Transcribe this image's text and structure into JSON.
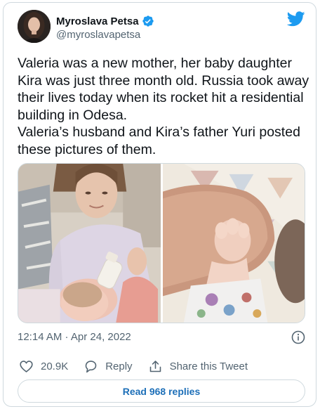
{
  "tweet": {
    "author": {
      "display_name": "Myroslava Petsa",
      "handle": "@myroslavapetsa",
      "verified": true
    },
    "text": "Valeria was a new mother, her baby daughter Kira was just three month old. Russia took away their lives today when its rocket hit a residential building in Odesa.\nValeria’s husband and Kira’s father Yuri posted these pictures of them.",
    "timestamp": "12:14 AM · Apr 24, 2022",
    "actions": {
      "likes": "20.9K",
      "reply_label": "Reply",
      "share_label": "Share this Tweet"
    },
    "read_replies_label": "Read 968 replies",
    "media": [
      {
        "description_icon": "photo-mother-baby"
      },
      {
        "description_icon": "photo-baby-hand"
      }
    ]
  },
  "colors": {
    "brand_blue": "#1d9bf0",
    "link_blue": "#1d6fb8",
    "secondary_text": "#536471",
    "border": "#cfd9de"
  }
}
